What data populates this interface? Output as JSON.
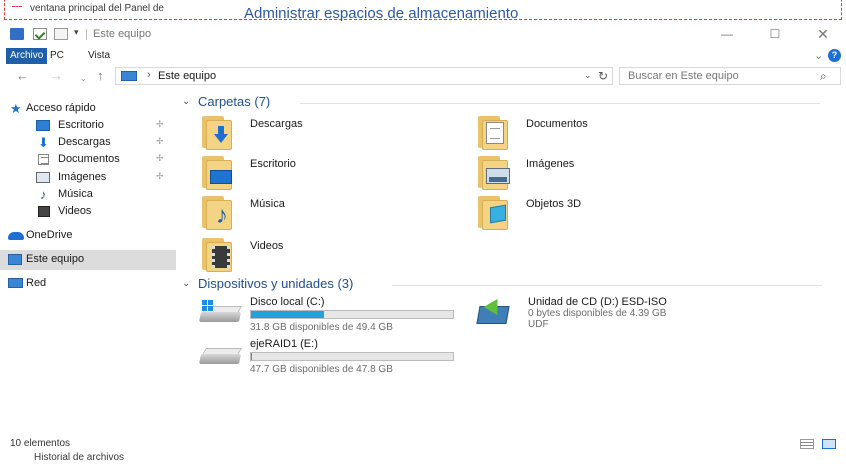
{
  "background": {
    "top_fragment_left": "ventana principal del Panel de",
    "top_fragment_big": "Administrar espacios de almacenamiento",
    "bottom_fragment": "Historial de archivos"
  },
  "window": {
    "title": "Este equipo",
    "quick_access_dropdown": "▾",
    "controls": {
      "minimize": "—",
      "maximize": "☐",
      "close": "✕"
    }
  },
  "ribbon": {
    "tabs": [
      "Archivo",
      "PC",
      "Vista"
    ],
    "active_tab": "Archivo",
    "collapse_glyph": "⌄",
    "help_glyph": "?"
  },
  "address": {
    "back_glyph": "←",
    "forward_glyph": "→",
    "history_glyph": "⌄",
    "up_glyph": "↑",
    "separator": "›",
    "path": "Este equipo",
    "dropdown_glyph": "⌄",
    "refresh_glyph": "↻",
    "search_placeholder": "Buscar en Este equipo",
    "search_glyph": "⌕"
  },
  "nav": {
    "items": [
      {
        "label": "Acceso rápido",
        "icon": "quick-access-star-icon",
        "pinned": false
      },
      {
        "label": "Escritorio",
        "icon": "desktop-icon",
        "pinned": true
      },
      {
        "label": "Descargas",
        "icon": "download-icon",
        "pinned": true
      },
      {
        "label": "Documentos",
        "icon": "documents-icon",
        "pinned": true
      },
      {
        "label": "Imágenes",
        "icon": "images-icon",
        "pinned": true
      },
      {
        "label": "Música",
        "icon": "music-icon",
        "pinned": false
      },
      {
        "label": "Videos",
        "icon": "video-icon",
        "pinned": false
      },
      {
        "label": "OneDrive",
        "icon": "onedrive-cloud-icon",
        "pinned": false
      },
      {
        "label": "Este equipo",
        "icon": "this-pc-icon",
        "pinned": false,
        "selected": true
      },
      {
        "label": "Red",
        "icon": "network-icon",
        "pinned": false
      }
    ],
    "pin_glyph": "📌"
  },
  "content": {
    "folders_group": {
      "title": "Carpetas (7)",
      "chevron": "⌄",
      "items": [
        {
          "name": "Descargas",
          "icon": "downloads-folder-icon"
        },
        {
          "name": "Documentos",
          "icon": "documents-folder-icon"
        },
        {
          "name": "Escritorio",
          "icon": "desktop-folder-icon"
        },
        {
          "name": "Imágenes",
          "icon": "pictures-folder-icon"
        },
        {
          "name": "Música",
          "icon": "music-folder-icon"
        },
        {
          "name": "Objetos 3D",
          "icon": "3d-objects-folder-icon"
        },
        {
          "name": "Videos",
          "icon": "videos-folder-icon"
        }
      ]
    },
    "devices_group": {
      "title": "Dispositivos y unidades (3)",
      "chevron": "⌄",
      "items": [
        {
          "name": "Disco local (C:)",
          "free": "31.8 GB disponibles de 49.4 GB",
          "used_fraction": 0.36,
          "icon": "windows-drive-icon"
        },
        {
          "name": "Unidad de CD (D:) ESD-ISO",
          "free": "0 bytes disponibles de 4.39 GB",
          "filesystem": "UDF",
          "icon": "cd-drive-icon"
        },
        {
          "name": "ejeRAID1 (E:)",
          "free": "47.7 GB disponibles de 47.8 GB",
          "used_fraction": 0.002,
          "icon": "hard-drive-icon"
        }
      ]
    }
  },
  "status": {
    "count_text": "10 elementos"
  },
  "colors": {
    "accent": "#1f5ea8",
    "selection": "#dcdcdc",
    "drive_bar": "#26a0da",
    "group_title": "#1f4f8f"
  }
}
